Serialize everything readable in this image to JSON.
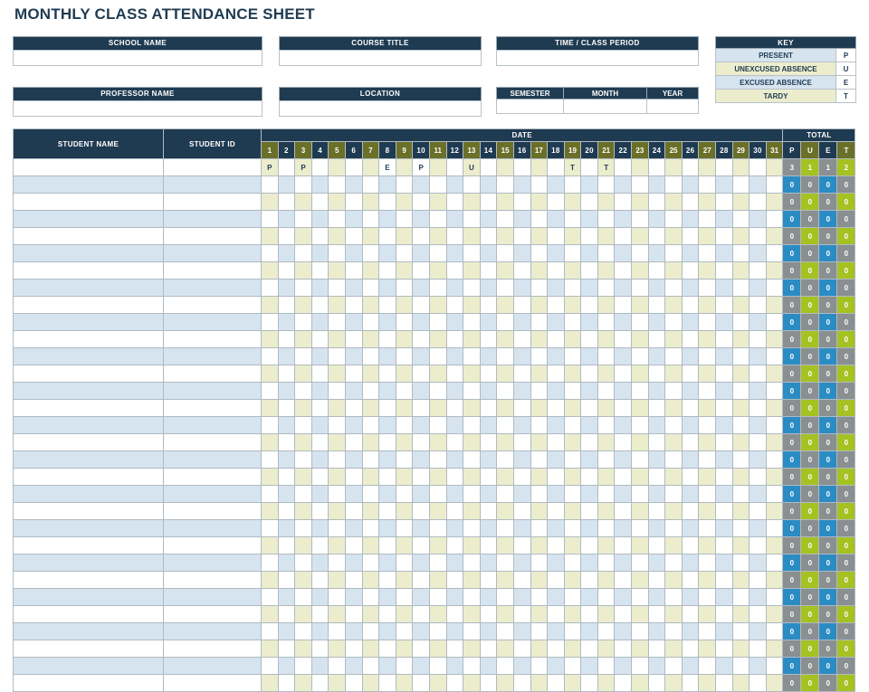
{
  "document": {
    "title": "MONTHLY CLASS ATTENDANCE SHEET"
  },
  "fields": [
    {
      "label": "SCHOOL NAME",
      "value": ""
    },
    {
      "label": "COURSE TITLE",
      "value": ""
    },
    {
      "label": "TIME / CLASS PERIOD",
      "value": ""
    },
    {
      "label": "PROFESSOR NAME",
      "value": ""
    },
    {
      "label": "LOCATION",
      "value": ""
    }
  ],
  "period": {
    "headers": [
      "SEMESTER",
      "MONTH",
      "YEAR"
    ],
    "values": [
      "",
      "",
      ""
    ]
  },
  "key": {
    "title": "KEY",
    "rows": [
      {
        "label": "PRESENT",
        "code": "P",
        "tone": "blue"
      },
      {
        "label": "UNEXCUSED ABSENCE",
        "code": "U",
        "tone": "olive"
      },
      {
        "label": "EXCUSED ABSENCE",
        "code": "E",
        "tone": "blue"
      },
      {
        "label": "TARDY",
        "code": "T",
        "tone": "olive"
      }
    ]
  },
  "table": {
    "headers": {
      "student_name": "STUDENT NAME",
      "student_id": "STUDENT ID",
      "date": "DATE",
      "total": "TOTAL"
    },
    "days": [
      1,
      2,
      3,
      4,
      5,
      6,
      7,
      8,
      9,
      10,
      11,
      12,
      13,
      14,
      15,
      16,
      17,
      18,
      19,
      20,
      21,
      22,
      23,
      24,
      25,
      26,
      27,
      28,
      29,
      30,
      31
    ],
    "total_columns": [
      "P",
      "U",
      "E",
      "T"
    ],
    "rows": [
      {
        "name": "",
        "id": "",
        "marks": {
          "1": "P",
          "3": "P",
          "8": "E",
          "10": "P",
          "13": "U",
          "19": "T",
          "21": "T"
        },
        "totals": [
          "3",
          "1",
          "1",
          "2"
        ]
      },
      {
        "name": "",
        "id": "",
        "marks": {},
        "totals": [
          "0",
          "0",
          "0",
          "0"
        ]
      },
      {
        "name": "",
        "id": "",
        "marks": {},
        "totals": [
          "0",
          "0",
          "0",
          "0"
        ]
      },
      {
        "name": "",
        "id": "",
        "marks": {},
        "totals": [
          "0",
          "0",
          "0",
          "0"
        ]
      },
      {
        "name": "",
        "id": "",
        "marks": {},
        "totals": [
          "0",
          "0",
          "0",
          "0"
        ]
      },
      {
        "name": "",
        "id": "",
        "marks": {},
        "totals": [
          "0",
          "0",
          "0",
          "0"
        ]
      },
      {
        "name": "",
        "id": "",
        "marks": {},
        "totals": [
          "0",
          "0",
          "0",
          "0"
        ]
      },
      {
        "name": "",
        "id": "",
        "marks": {},
        "totals": [
          "0",
          "0",
          "0",
          "0"
        ]
      },
      {
        "name": "",
        "id": "",
        "marks": {},
        "totals": [
          "0",
          "0",
          "0",
          "0"
        ]
      },
      {
        "name": "",
        "id": "",
        "marks": {},
        "totals": [
          "0",
          "0",
          "0",
          "0"
        ]
      },
      {
        "name": "",
        "id": "",
        "marks": {},
        "totals": [
          "0",
          "0",
          "0",
          "0"
        ]
      },
      {
        "name": "",
        "id": "",
        "marks": {},
        "totals": [
          "0",
          "0",
          "0",
          "0"
        ]
      },
      {
        "name": "",
        "id": "",
        "marks": {},
        "totals": [
          "0",
          "0",
          "0",
          "0"
        ]
      },
      {
        "name": "",
        "id": "",
        "marks": {},
        "totals": [
          "0",
          "0",
          "0",
          "0"
        ]
      },
      {
        "name": "",
        "id": "",
        "marks": {},
        "totals": [
          "0",
          "0",
          "0",
          "0"
        ]
      },
      {
        "name": "",
        "id": "",
        "marks": {},
        "totals": [
          "0",
          "0",
          "0",
          "0"
        ]
      },
      {
        "name": "",
        "id": "",
        "marks": {},
        "totals": [
          "0",
          "0",
          "0",
          "0"
        ]
      },
      {
        "name": "",
        "id": "",
        "marks": {},
        "totals": [
          "0",
          "0",
          "0",
          "0"
        ]
      },
      {
        "name": "",
        "id": "",
        "marks": {},
        "totals": [
          "0",
          "0",
          "0",
          "0"
        ]
      },
      {
        "name": "",
        "id": "",
        "marks": {},
        "totals": [
          "0",
          "0",
          "0",
          "0"
        ]
      },
      {
        "name": "",
        "id": "",
        "marks": {},
        "totals": [
          "0",
          "0",
          "0",
          "0"
        ]
      },
      {
        "name": "",
        "id": "",
        "marks": {},
        "totals": [
          "0",
          "0",
          "0",
          "0"
        ]
      },
      {
        "name": "",
        "id": "",
        "marks": {},
        "totals": [
          "0",
          "0",
          "0",
          "0"
        ]
      },
      {
        "name": "",
        "id": "",
        "marks": {},
        "totals": [
          "0",
          "0",
          "0",
          "0"
        ]
      },
      {
        "name": "",
        "id": "",
        "marks": {},
        "totals": [
          "0",
          "0",
          "0",
          "0"
        ]
      },
      {
        "name": "",
        "id": "",
        "marks": {},
        "totals": [
          "0",
          "0",
          "0",
          "0"
        ]
      },
      {
        "name": "",
        "id": "",
        "marks": {},
        "totals": [
          "0",
          "0",
          "0",
          "0"
        ]
      },
      {
        "name": "",
        "id": "",
        "marks": {},
        "totals": [
          "0",
          "0",
          "0",
          "0"
        ]
      },
      {
        "name": "",
        "id": "",
        "marks": {},
        "totals": [
          "0",
          "0",
          "0",
          "0"
        ]
      },
      {
        "name": "",
        "id": "",
        "marks": {},
        "totals": [
          "0",
          "0",
          "0",
          "0"
        ]
      },
      {
        "name": "",
        "id": "",
        "marks": {},
        "totals": [
          "0",
          "0",
          "0",
          "0"
        ]
      }
    ]
  },
  "colors": {
    "navy": "#1f3b52",
    "olive_header": "#6b7029",
    "olive_cell": "#ecedcd",
    "blue_cell": "#d6e4f0",
    "total_gray": "#8a8f91",
    "total_olive": "#a6c122",
    "total_blue": "#2b8cc4"
  }
}
